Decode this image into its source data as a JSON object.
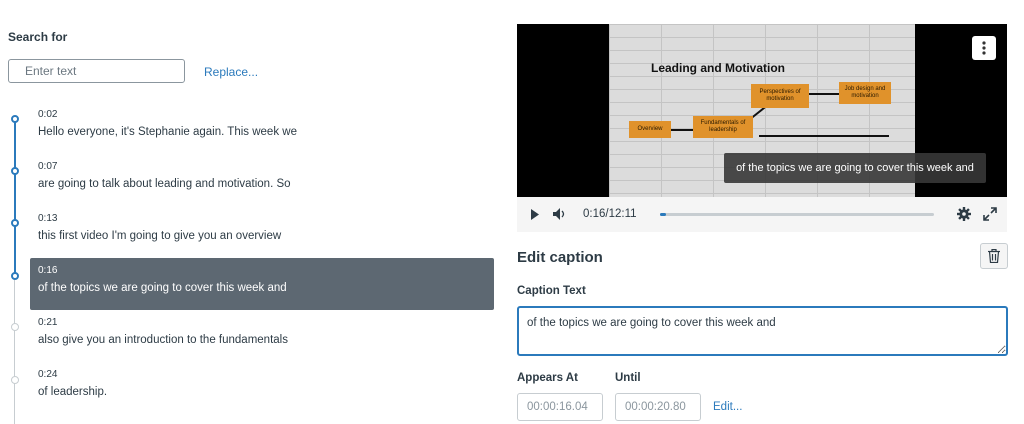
{
  "search": {
    "label": "Search for",
    "placeholder": "Enter text",
    "replace_link": "Replace..."
  },
  "cues": [
    {
      "time": "0:02",
      "text": "Hello everyone, it's Stephanie again. This week we",
      "state": "done"
    },
    {
      "time": "0:07",
      "text": "are going to talk about leading and motivation. So",
      "state": "done"
    },
    {
      "time": "0:13",
      "text": "this first video I'm going to give you an overview",
      "state": "done"
    },
    {
      "time": "0:16",
      "text": "of the topics we are going to cover this week and",
      "state": "selected"
    },
    {
      "time": "0:21",
      "text": "also give you an introduction to the fundamentals",
      "state": "future"
    },
    {
      "time": "0:24",
      "text": "of leadership.",
      "state": "future"
    }
  ],
  "video": {
    "slide_title": "Leading and Motivation",
    "slide_notes": [
      "Overview",
      "Fundamentals of leadership",
      "Perspectives of motivation",
      "Job design and motivation"
    ],
    "caption_overlay": "of the topics we are going to cover this week and",
    "time_readout": "0:16/12:11",
    "progress_fraction": 0.022
  },
  "editor": {
    "heading": "Edit caption",
    "caption_label": "Caption Text",
    "caption_value": "of the topics we are going to cover this week and",
    "appears_label": "Appears At",
    "until_label": "Until",
    "appears_value": "00:00:16.04",
    "until_value": "00:00:20.80",
    "edit_link": "Edit..."
  },
  "colors": {
    "accent": "#2b7abc",
    "selected_row": "#5d6872",
    "slide_note": "#e0922b"
  },
  "icons": [
    "play-icon",
    "volume-icon",
    "gear-icon",
    "fullscreen-icon",
    "more-vertical-icon",
    "trash-icon"
  ]
}
